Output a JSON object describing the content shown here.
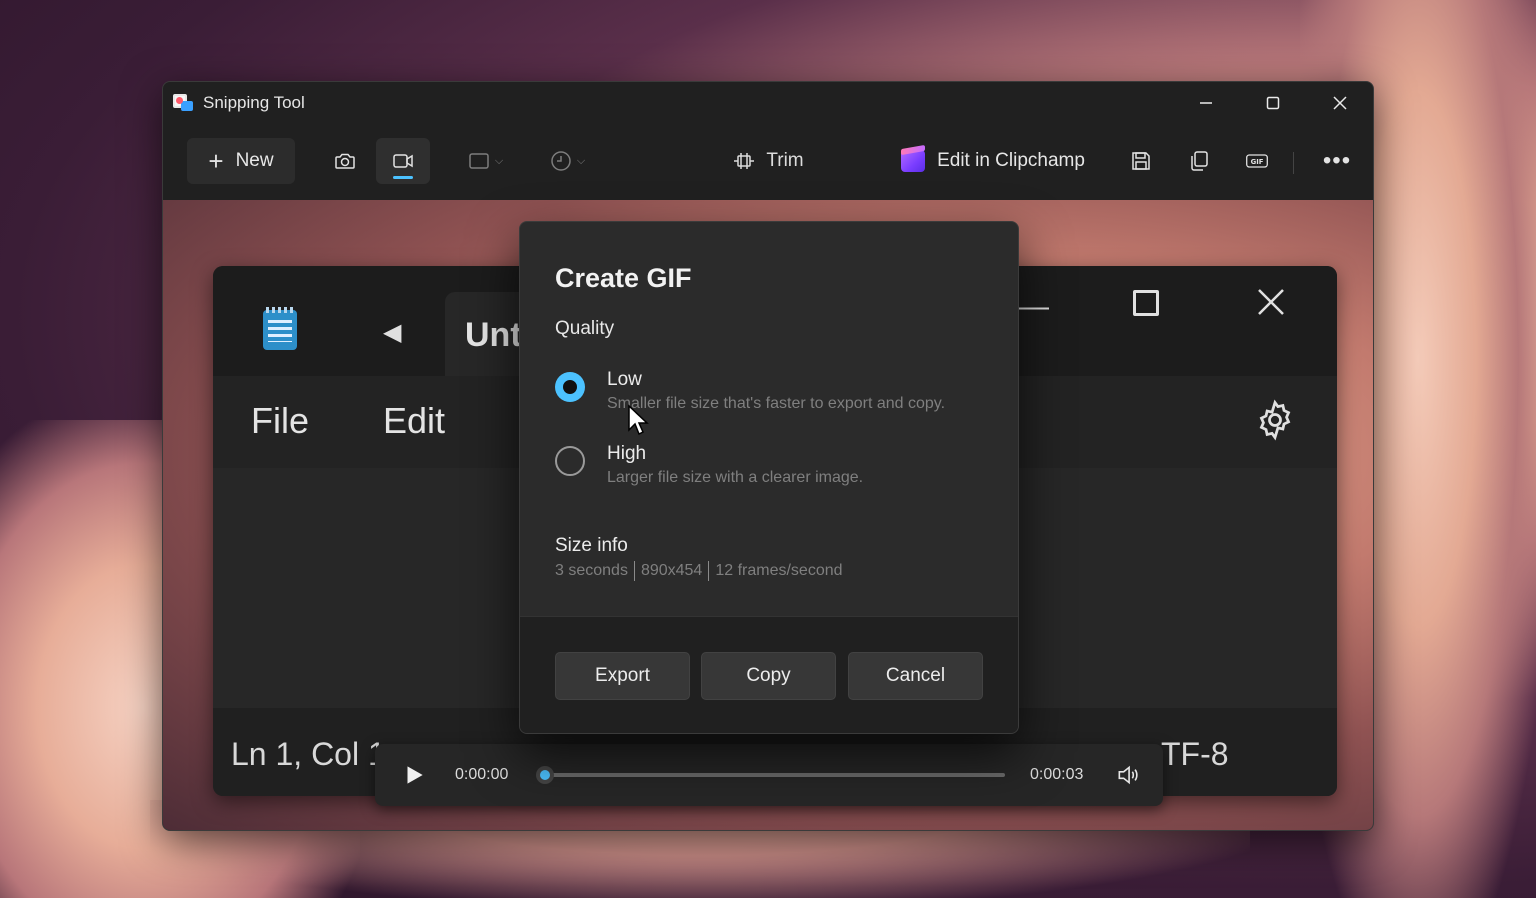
{
  "window": {
    "title": "Snipping Tool"
  },
  "toolbar": {
    "new_label": "New",
    "trim_label": "Trim",
    "clipchamp_label": "Edit in Clipchamp",
    "gif_label": "GIF",
    "more_label": "•••"
  },
  "notepad": {
    "tab_title": "Unt",
    "menu_file": "File",
    "menu_edit": "Edit",
    "status_position": "Ln 1, Col 1",
    "status_encoding": "TF-8"
  },
  "player": {
    "time_start": "0:00:00",
    "time_end": "0:00:03",
    "progress": 0
  },
  "dialog": {
    "title": "Create GIF",
    "quality_label": "Quality",
    "options": [
      {
        "title": "Low",
        "description": "Smaller file size that's faster to export and copy.",
        "selected": true
      },
      {
        "title": "High",
        "description": "Larger file size with a clearer image.",
        "selected": false
      }
    ],
    "size_info_label": "Size info",
    "size_info": [
      "3 seconds",
      "890x454",
      "12 frames/second"
    ],
    "buttons": {
      "export": "Export",
      "copy": "Copy",
      "cancel": "Cancel"
    }
  },
  "colors": {
    "accent": "#4cc2ff",
    "window_bg": "#202020",
    "dialog_bg": "#2b2b2b"
  }
}
